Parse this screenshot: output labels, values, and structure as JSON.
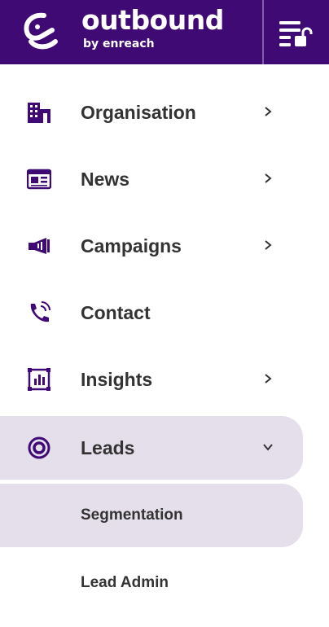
{
  "colors": {
    "brand": "#3f0a74",
    "icon": "#3f0a74",
    "active_bg": "#e5dfeb",
    "text": "#333333"
  },
  "header": {
    "brand_name": "outbound",
    "brand_sub": "by enreach",
    "logo_icon": "enreach-logo-icon",
    "menu_icon": "menu-unlock-icon"
  },
  "nav": {
    "items": [
      {
        "label": "Organisation",
        "icon": "building-icon",
        "has_submenu": true,
        "expanded": false
      },
      {
        "label": "News",
        "icon": "newspaper-icon",
        "has_submenu": true,
        "expanded": false
      },
      {
        "label": "Campaigns",
        "icon": "megaphone-icon",
        "has_submenu": true,
        "expanded": false
      },
      {
        "label": "Contact",
        "icon": "phone-icon",
        "has_submenu": false,
        "expanded": false
      },
      {
        "label": "Insights",
        "icon": "chart-icon",
        "has_submenu": true,
        "expanded": false
      },
      {
        "label": "Leads",
        "icon": "target-icon",
        "has_submenu": true,
        "expanded": true,
        "active": true
      }
    ],
    "subitems": [
      {
        "label": "Segmentation",
        "active": true
      },
      {
        "label": "Lead Admin",
        "active": false
      }
    ]
  }
}
